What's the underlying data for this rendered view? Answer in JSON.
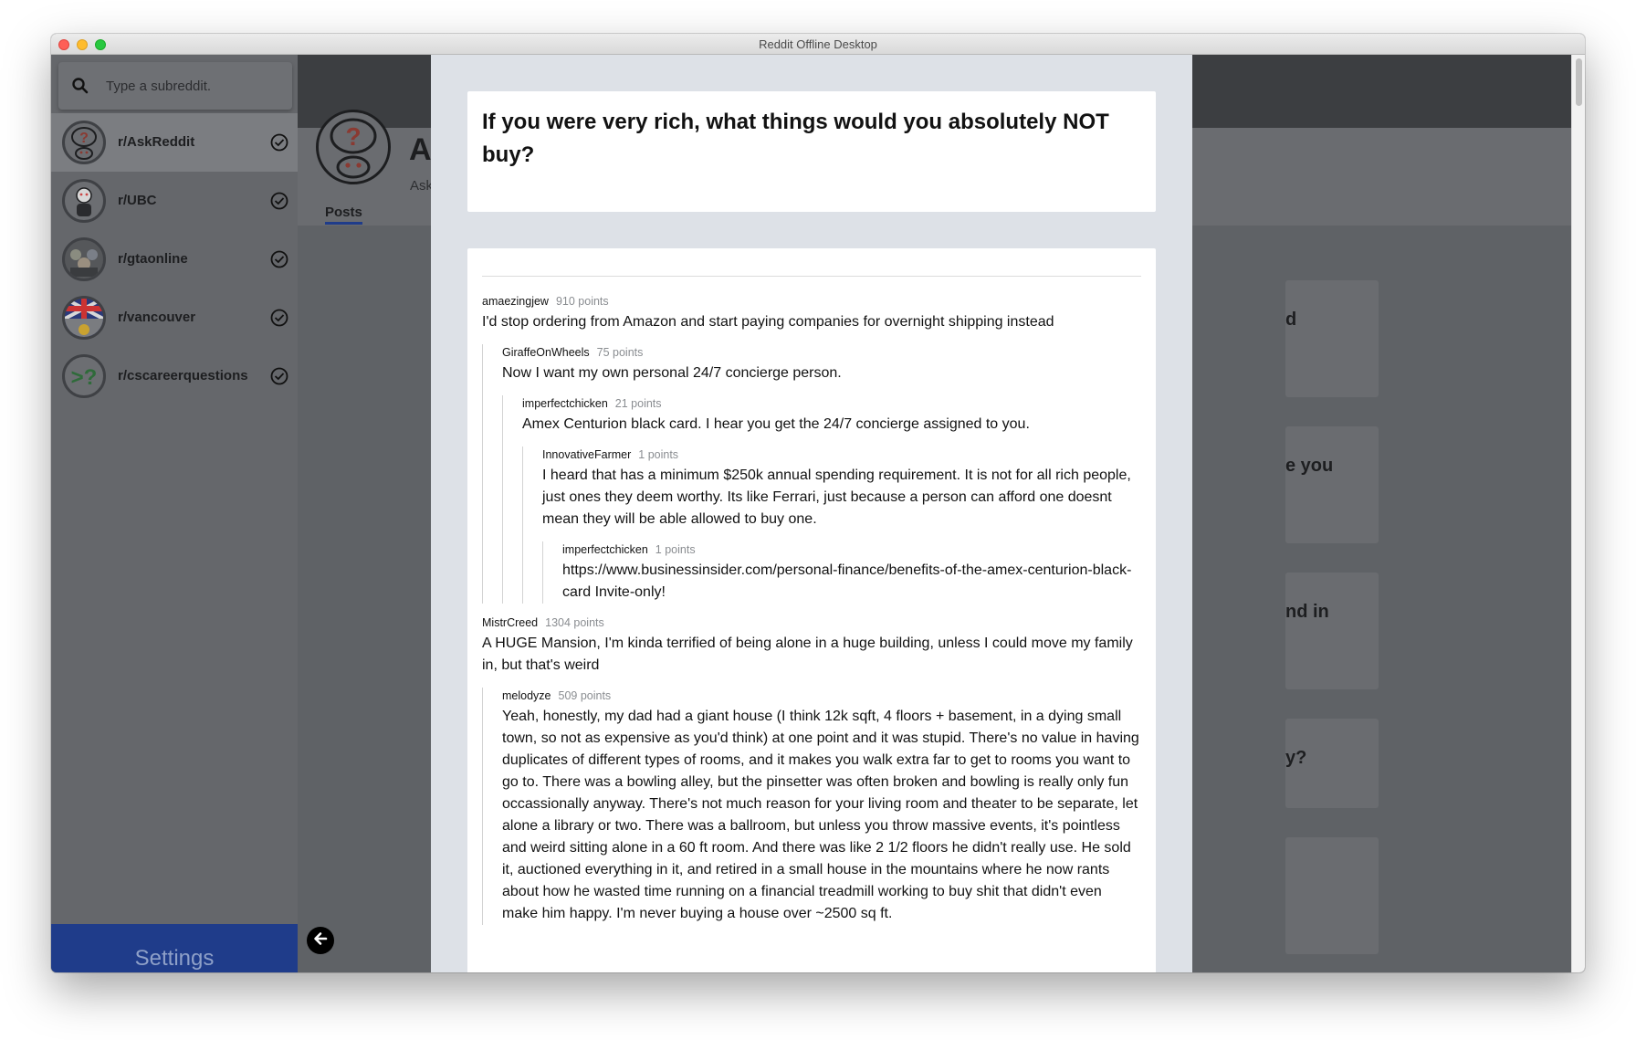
{
  "window": {
    "title": "Reddit Offline Desktop"
  },
  "sidebar": {
    "search_placeholder": "Type a subreddit.",
    "subreddits": [
      {
        "label": "r/AskReddit",
        "active": true
      },
      {
        "label": "r/UBC",
        "active": false
      },
      {
        "label": "r/gtaonline",
        "active": false
      },
      {
        "label": "r/vancouver",
        "active": false
      },
      {
        "label": "r/cscareerquestions",
        "active": false
      }
    ],
    "settings_label": "Settings"
  },
  "header": {
    "initial": "A",
    "subtitle": "Ask",
    "posts_tab": "Posts"
  },
  "background_cards": [
    "d",
    "e you",
    "nd in",
    "y?"
  ],
  "post": {
    "title": "If you were very rich, what things would you absolutely NOT buy?",
    "comments": [
      {
        "author": "amaezingjew",
        "points": "910 points",
        "body": "I'd stop ordering from Amazon and start paying companies for overnight shipping instead"
      },
      {
        "author": "GiraffeOnWheels",
        "points": "75 points",
        "body": "Now I want my own personal 24/7 concierge person."
      },
      {
        "author": "imperfectchicken",
        "points": "21 points",
        "body": "Amex Centurion black card. I hear you get the 24/7 concierge assigned to you."
      },
      {
        "author": "InnovativeFarmer",
        "points": "1 points",
        "body": "I heard that has a minimum $250k annual spending requirement. It is not for all rich people, just ones they deem worthy. Its like Ferrari, just because a person can afford one doesnt mean they will be able allowed to buy one."
      },
      {
        "author": "imperfectchicken",
        "points": "1 points",
        "body": "https://www.businessinsider.com/personal-finance/benefits-of-the-amex-centurion-black-card Invite-only!"
      },
      {
        "author": "MistrCreed",
        "points": "1304 points",
        "body": "A HUGE Mansion, I'm kinda terrified of being alone in a huge building, unless I could move my family in, but that's weird"
      },
      {
        "author": "melodyze",
        "points": "509 points",
        "body": "Yeah, honestly, my dad had a giant house (I think 12k sqft, 4 floors + basement, in a dying small town, so not as expensive as you'd think) at one point and it was stupid. There's no value in having duplicates of different types of rooms, and it makes you walk extra far to get to rooms you want to go to. There was a bowling alley, but the pinsetter was often broken and bowling is really only fun occassionally anyway. There's not much reason for your living room and theater to be separate, let alone a library or two. There was a ballroom, but unless you throw massive events, it's pointless and weird sitting alone in a 60 ft room. And there was like 2 1/2 floors he didn't really use. He sold it, auctioned everything in it, and retired in a small house in the mountains where he now rants about how he wasted time running on a financial treadmill working to buy shit that didn't even make him happy. I'm never buying a house over ~2500 sq ft."
      }
    ]
  },
  "colors": {
    "accent": "#1f3c8a",
    "modal_bg": "#dde1e7",
    "overlay": "#5f6266"
  }
}
